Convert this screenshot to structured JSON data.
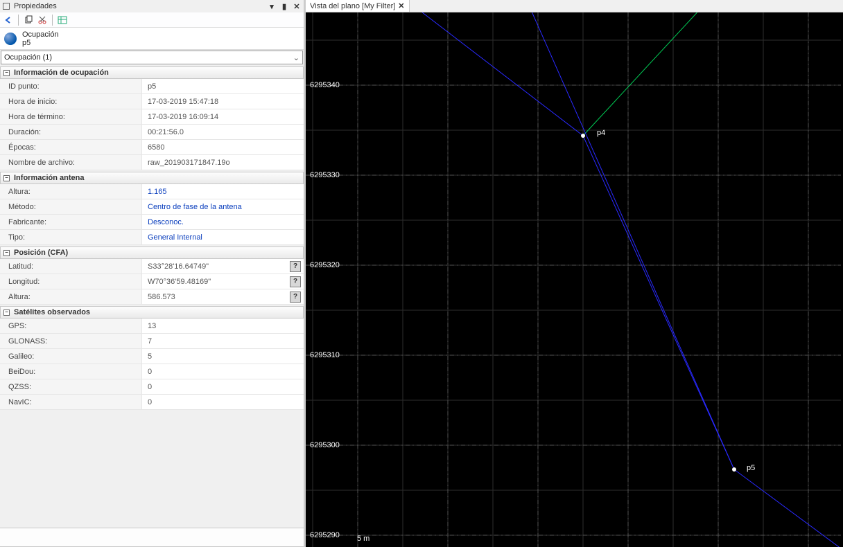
{
  "panel_title": "Propiedades",
  "globe": {
    "line1": "Ocupación",
    "line2": "p5"
  },
  "section_selector": "Ocupación (1)",
  "groups": {
    "occupation": {
      "title": "Información de ocupación",
      "rows": {
        "id_point": {
          "k": "ID punto:",
          "v": "p5"
        },
        "start": {
          "k": "Hora de inicio:",
          "v": "17-03-2019 15:47:18"
        },
        "end": {
          "k": "Hora de término:",
          "v": "17-03-2019 16:09:14"
        },
        "duration": {
          "k": "Duración:",
          "v": "00:21:56.0"
        },
        "epochs": {
          "k": "Épocas:",
          "v": "6580"
        },
        "filename": {
          "k": "Nombre de archivo:",
          "v": "raw_201903171847.19o"
        }
      }
    },
    "antenna": {
      "title": "Información antena",
      "rows": {
        "height": {
          "k": "Altura:",
          "v": "1.165"
        },
        "method": {
          "k": "Método:",
          "v": "Centro de fase de la antena"
        },
        "maker": {
          "k": "Fabricante:",
          "v": "Desconoc."
        },
        "type": {
          "k": "Tipo:",
          "v": "General Internal"
        }
      }
    },
    "position": {
      "title": "Posición (CFA)",
      "rows": {
        "lat": {
          "k": "Latitud:",
          "v": "S33°28'16.64749\""
        },
        "lon": {
          "k": "Longitud:",
          "v": "W70°36'59.48169\""
        },
        "alt": {
          "k": "Altura:",
          "v": "586.573"
        }
      }
    },
    "sats": {
      "title": "Satélites observados",
      "rows": {
        "gps": {
          "k": "GPS:",
          "v": "13"
        },
        "glonass": {
          "k": "GLONASS:",
          "v": "7"
        },
        "galileo": {
          "k": "Galileo:",
          "v": "5"
        },
        "beidou": {
          "k": "BeiDou:",
          "v": "0"
        },
        "qzss": {
          "k": "QZSS:",
          "v": "0"
        },
        "navic": {
          "k": "NavIC:",
          "v": "0"
        }
      }
    }
  },
  "right_tab": "Vista del plano [My Filter]",
  "ylabels": [
    "6295340",
    "6295330",
    "6295320",
    "6295310",
    "6295300",
    "6295290"
  ],
  "points": {
    "p4": "p4",
    "p5": "p5"
  },
  "scale": "5 m"
}
